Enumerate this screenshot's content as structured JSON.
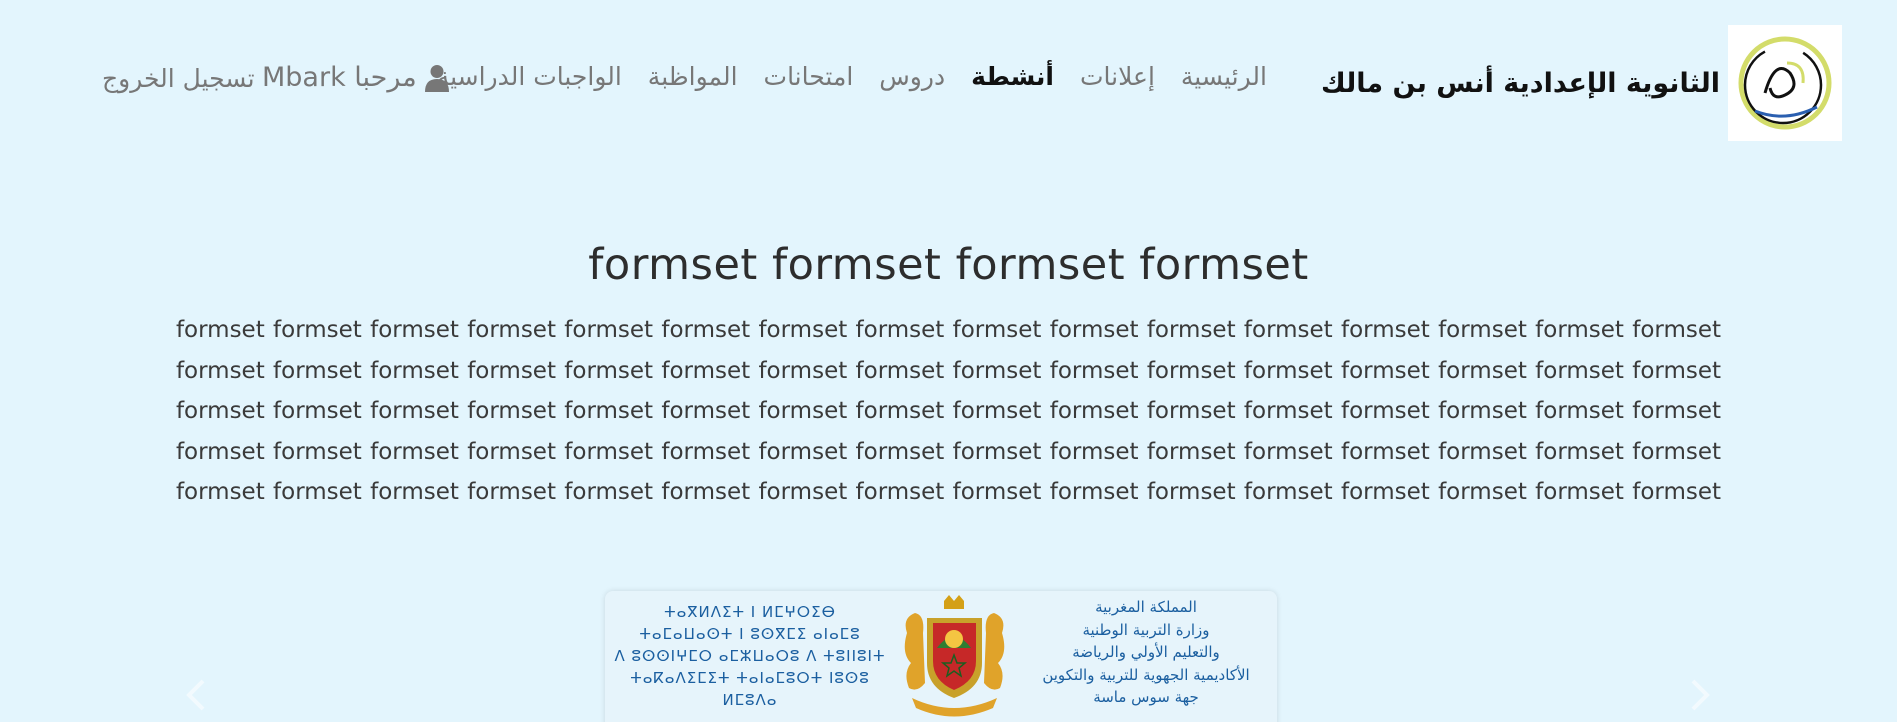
{
  "header": {
    "brand_name": "الثانوية الإعدادية أنس بن مالك",
    "brand_logo_icon": "school-logo-icon"
  },
  "nav": {
    "items": [
      {
        "label": "الرئيسية",
        "active": false
      },
      {
        "label": "إعلانات",
        "active": false
      },
      {
        "label": "أنشطة",
        "active": true
      },
      {
        "label": "دروس",
        "active": false
      },
      {
        "label": "امتحانات",
        "active": false
      },
      {
        "label": "المواظبة",
        "active": false
      },
      {
        "label": "الواجبات الدراسية",
        "active": false
      }
    ],
    "user_greeting": "مرحبا Mbark",
    "user_icon": "user-icon",
    "logout_label": "تسجيل الخروج"
  },
  "main": {
    "title": "formset formset formset formset",
    "body": "formset formset formset formset formset formset formset formset formset formset formset formset formset formset formset formset formset formset formset formset formset formset formset formset formset formset formset formset formset formset formset formset formset formset formset formset formset formset formset formset formset formset formset formset formset formset formset formset formset formset formset formset formset formset formset formset formset formset formset formset formset formset formset formset formset formset formset formset formset formset formset formset formset formset formset formset formset formset formset formset"
  },
  "carousel": {
    "prev_icon": "chevron-left-icon",
    "next_icon": "chevron-right-icon",
    "slide": {
      "tifinagh_lines": [
        "ⵜⴰⴳⵍⴷⵉⵜ ⵏ ⵍⵎⵖⵔⵉⴱ",
        "ⵜⴰⵎⴰⵡⴰⵙⵜ ⵏ ⵓⵙⴳⵎⵉ ⴰⵏⴰⵎⵓ",
        "ⴷ ⵓⵙⵙⵏⵖⵎⵔ ⴰⵎⵣⵡⴰⵔⵓ ⴷ ⵜⵓⵏⵏⵓⵏⵜ",
        "ⵜⴰⴽⴰⴷⵉⵎⵉⵜ ⵜⴰⵏⴰⵎⵓⵔⵜ ⵏⵓⵙⵓ ⵍⵎⵓⴷⴰ"
      ],
      "arabic_lines": [
        "المملكة المغربية",
        "وزارة التربية الوطنية",
        "والتعليم الأولي والرياضة",
        "الأكاديمية الجهوية للتربية والتكوين",
        "جهة سوس ماسة"
      ],
      "emblem_icon": "coat-of-arms-icon"
    }
  },
  "colors": {
    "background": "#e3f5fd",
    "nav_text": "#777777",
    "nav_active": "#111111",
    "slide_text": "#1b5fa0"
  }
}
